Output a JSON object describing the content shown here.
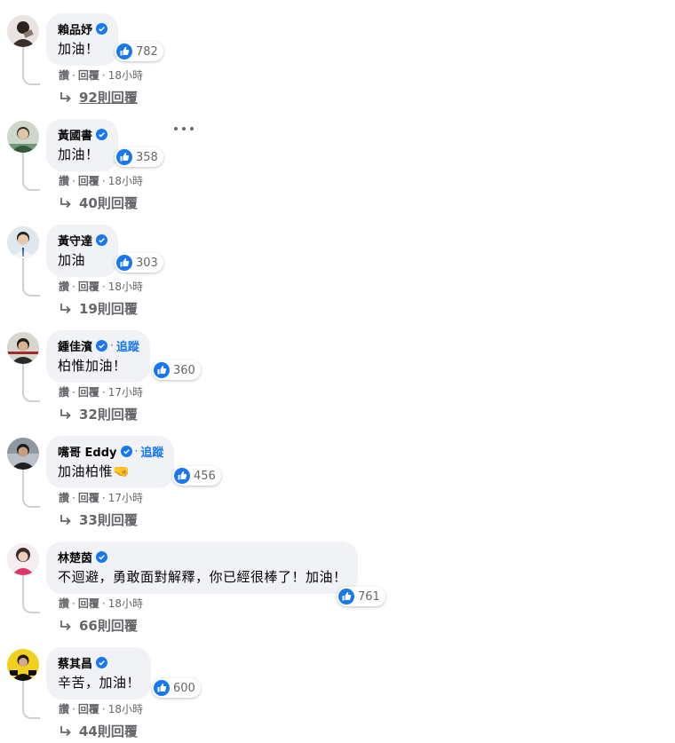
{
  "actions": {
    "like": "讚",
    "reply": "回覆",
    "dot": "·"
  },
  "comments": [
    {
      "name": "賴品妤",
      "text": "加油！",
      "likes": "782",
      "time": "18小時",
      "replies": "92則回覆"
    },
    {
      "name": "黃國書",
      "text": "加油！",
      "likes": "358",
      "time": "18小時",
      "replies": "40則回覆"
    },
    {
      "name": "黃守達",
      "text": "加油",
      "likes": "303",
      "time": "18小時",
      "replies": "19則回覆"
    },
    {
      "name": "鍾佳濱",
      "follow": "追蹤",
      "text": "柏惟加油！",
      "likes": "360",
      "time": "17小時",
      "replies": "32則回覆"
    },
    {
      "name": "嘴哥 Eddy",
      "follow": "追蹤",
      "text": "加油柏惟🤜",
      "likes": "456",
      "time": "17小時",
      "replies": "33則回覆"
    },
    {
      "name": "林楚茵",
      "text": "不迴避，勇敢面對解釋，你已經很棒了！加油！",
      "likes": "761",
      "time": "18小時",
      "replies": "66則回覆"
    },
    {
      "name": "蔡其昌",
      "text": "辛苦，加油！",
      "likes": "600",
      "time": "18小時",
      "replies": "44則回覆"
    }
  ],
  "colors": {
    "verified": "#1877f2",
    "like": "#1877f2",
    "bubble": "#f0f2f5",
    "follow": "#1877f2"
  }
}
